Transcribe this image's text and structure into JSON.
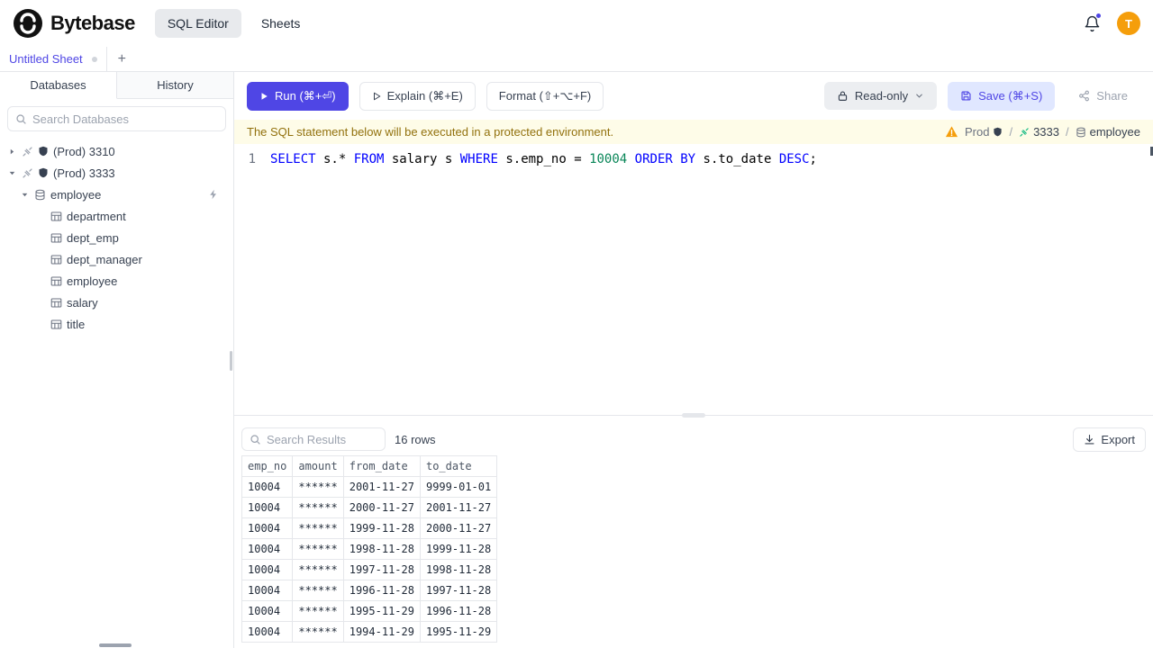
{
  "colors": {
    "accent": "#4f46e5",
    "notice_bg": "#fefce8",
    "notice_text": "#92710d",
    "keyword": "#0000ff",
    "number_literal": "#098658",
    "avatar_bg": "#f59e0b"
  },
  "header": {
    "brand": "Bytebase",
    "nav": [
      {
        "label": "SQL Editor",
        "active": true
      },
      {
        "label": "Sheets",
        "active": false
      }
    ],
    "avatar_initial": "T"
  },
  "tabs": {
    "active_tab": "Untitled Sheet",
    "add_label": "+"
  },
  "sidebar": {
    "tabs": [
      {
        "label": "Databases",
        "active": true
      },
      {
        "label": "History",
        "active": false
      }
    ],
    "search_placeholder": "Search Databases",
    "tree": {
      "instances": [
        {
          "label": "(Prod) 3310",
          "expanded": false
        },
        {
          "label": "(Prod) 3333",
          "expanded": true
        }
      ],
      "database": "employee",
      "tables": [
        "department",
        "dept_emp",
        "dept_manager",
        "employee",
        "salary",
        "title"
      ]
    }
  },
  "toolbar": {
    "run_label": "Run (⌘+⏎)",
    "explain_label": "Explain (⌘+E)",
    "format_label": "Format (⇧+⌥+F)",
    "readonly_label": "Read-only",
    "save_label": "Save (⌘+S)",
    "share_label": "Share"
  },
  "notice": {
    "message": "The SQL statement below will be executed in a protected environment.",
    "environment": "Prod",
    "separator": "/",
    "instance": "3333",
    "database": "employee"
  },
  "editor": {
    "line_number": "1",
    "sql_text": "SELECT s.* FROM salary s WHERE s.emp_no = 10004 ORDER BY s.to_date DESC;",
    "tokens": [
      {
        "text": "SELECT",
        "type": "keyword"
      },
      {
        "text": " s.* ",
        "type": "plain"
      },
      {
        "text": "FROM",
        "type": "keyword"
      },
      {
        "text": " salary s ",
        "type": "plain"
      },
      {
        "text": "WHERE",
        "type": "keyword"
      },
      {
        "text": " s.emp_no = ",
        "type": "plain"
      },
      {
        "text": "10004",
        "type": "number"
      },
      {
        "text": " ",
        "type": "plain"
      },
      {
        "text": "ORDER BY",
        "type": "keyword"
      },
      {
        "text": " s.to_date ",
        "type": "plain"
      },
      {
        "text": "DESC",
        "type": "keyword"
      },
      {
        "text": ";",
        "type": "plain"
      }
    ]
  },
  "results": {
    "search_placeholder": "Search Results",
    "row_count": "16 rows",
    "export_label": "Export",
    "columns": [
      "emp_no",
      "amount",
      "from_date",
      "to_date"
    ],
    "rows": [
      [
        "10004",
        "******",
        "2001-11-27",
        "9999-01-01"
      ],
      [
        "10004",
        "******",
        "2000-11-27",
        "2001-11-27"
      ],
      [
        "10004",
        "******",
        "1999-11-28",
        "2000-11-27"
      ],
      [
        "10004",
        "******",
        "1998-11-28",
        "1999-11-28"
      ],
      [
        "10004",
        "******",
        "1997-11-28",
        "1998-11-28"
      ],
      [
        "10004",
        "******",
        "1996-11-28",
        "1997-11-28"
      ],
      [
        "10004",
        "******",
        "1995-11-29",
        "1996-11-28"
      ],
      [
        "10004",
        "******",
        "1994-11-29",
        "1995-11-29"
      ]
    ]
  }
}
